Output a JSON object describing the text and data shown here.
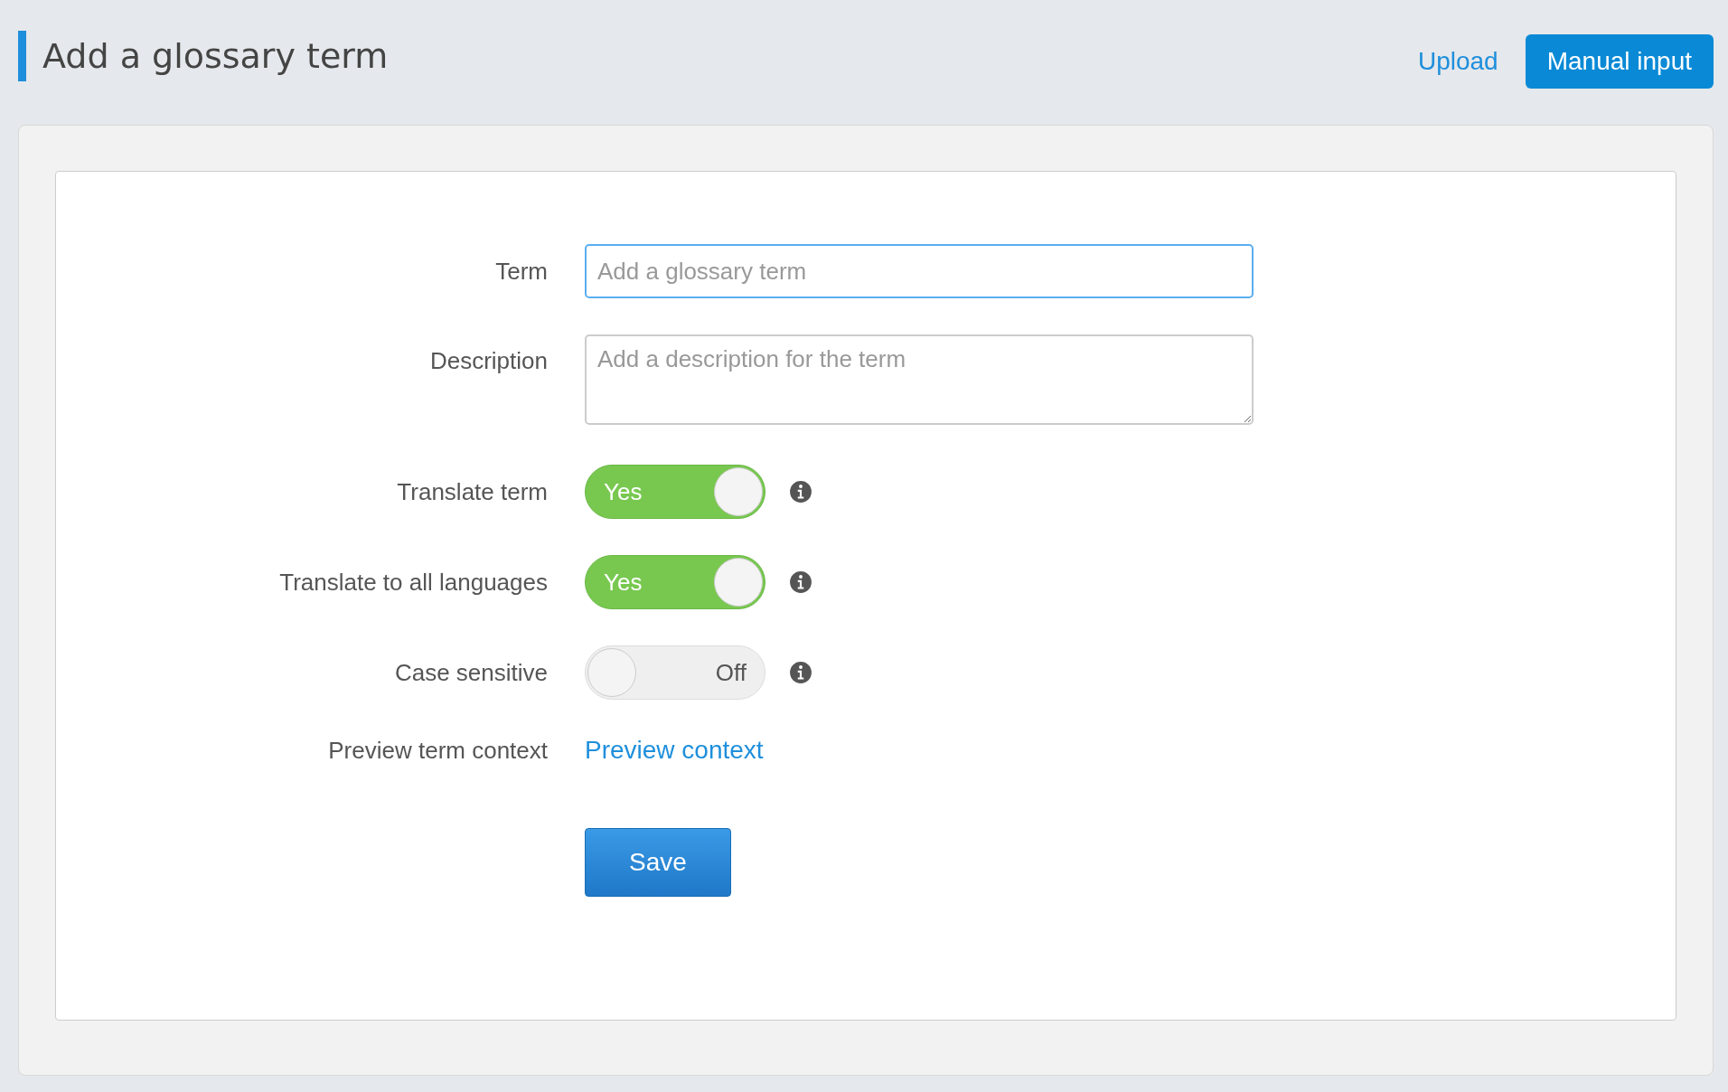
{
  "header": {
    "title": "Add a glossary term",
    "upload_link": "Upload",
    "manual_input_button": "Manual input"
  },
  "form": {
    "rows": [
      {
        "kind": "input",
        "label": "Term",
        "placeholder": "Add a glossary term"
      },
      {
        "kind": "textarea",
        "label": "Description",
        "placeholder": "Add a description for the term"
      },
      {
        "kind": "toggle",
        "label": "Translate term",
        "on": true,
        "toggle_text": "Yes"
      },
      {
        "kind": "toggle",
        "label": "Translate to all languages",
        "on": true,
        "toggle_text": "Yes"
      },
      {
        "kind": "toggle",
        "label": "Case sensitive",
        "on": false,
        "toggle_text": "Off"
      },
      {
        "kind": "link",
        "label": "Preview term context",
        "link_text": "Preview context"
      }
    ],
    "save_button": "Save"
  }
}
